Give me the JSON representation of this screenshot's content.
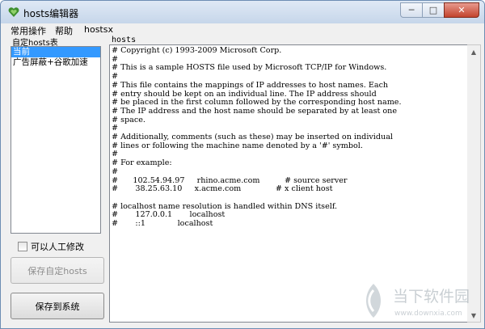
{
  "window": {
    "title": "hosts编辑器",
    "controls": {
      "minimize": "─",
      "maximize": "□",
      "close": "✕"
    }
  },
  "menu": [
    "常用操作",
    "帮助",
    "hostsx"
  ],
  "left": {
    "group_label": "自定hosts表",
    "items": [
      "当前",
      "广告屏蔽+谷歌加速"
    ],
    "selected_index": 0,
    "checkbox_label": "可以人工修改",
    "checkbox_checked": false,
    "save_custom_label": "保存自定hosts",
    "save_system_label": "保存到系统"
  },
  "editor": {
    "label": "hosts",
    "lines": [
      "# Copyright (c) 1993-2009 Microsoft Corp.",
      "#",
      "# This is a sample HOSTS file used by Microsoft TCP/IP for Windows.",
      "#",
      "# This file contains the mappings of IP addresses to host names. Each",
      "# entry should be kept on an individual line. The IP address should",
      "# be placed in the first column followed by the corresponding host name.",
      "# The IP address and the host name should be separated by at least one",
      "# space.",
      "#",
      "# Additionally, comments (such as these) may be inserted on individual",
      "# lines or following the machine name denoted by a '#' symbol.",
      "#",
      "# For example:",
      "#",
      "#      102.54.94.97     rhino.acme.com          # source server",
      "#       38.25.63.10     x.acme.com              # x client host",
      "",
      "# localhost name resolution is handled within DNS itself.",
      "#       127.0.0.1       localhost",
      "#       ::1             localhost"
    ]
  },
  "watermark": {
    "brand": "当下软件园",
    "url": "www.downxia.com"
  },
  "colors": {
    "selection": "#3399ff",
    "title_bar": "#c6d6ea"
  }
}
